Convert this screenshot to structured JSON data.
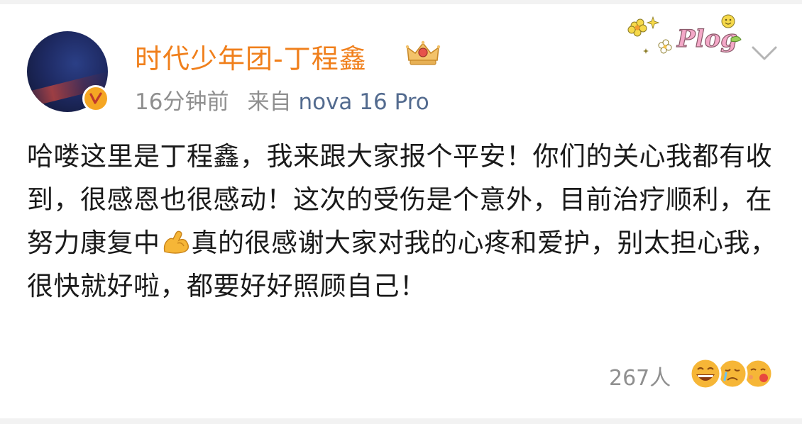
{
  "post": {
    "author": {
      "name": "时代少年团-丁程鑫",
      "badge_icon": "crown-icon",
      "verified_icon": "verified-v-icon",
      "name_color": "#f07f1b"
    },
    "meta": {
      "time": "16分钟前",
      "source_label": "来自",
      "device": "nova 16 Pro"
    },
    "body": {
      "text_before_emoji": "哈喽这里是丁程鑫，我来跟大家报个平安！你们的关心我都有收到，很感恩也很感动！这次的受伤是个意外，目前治疗顺利，在努力康复中",
      "emoji": "flexed-biceps-icon",
      "text_after_emoji": "真的很感谢大家对我的心疼和爱护，别太担心我，很快就好啦，都要好好照顾自己！"
    },
    "sticker_text": "Plog",
    "reactions": {
      "count": "267人",
      "icons": [
        "grinning-face-icon",
        "crying-face-icon",
        "kissing-face-icon"
      ]
    }
  }
}
